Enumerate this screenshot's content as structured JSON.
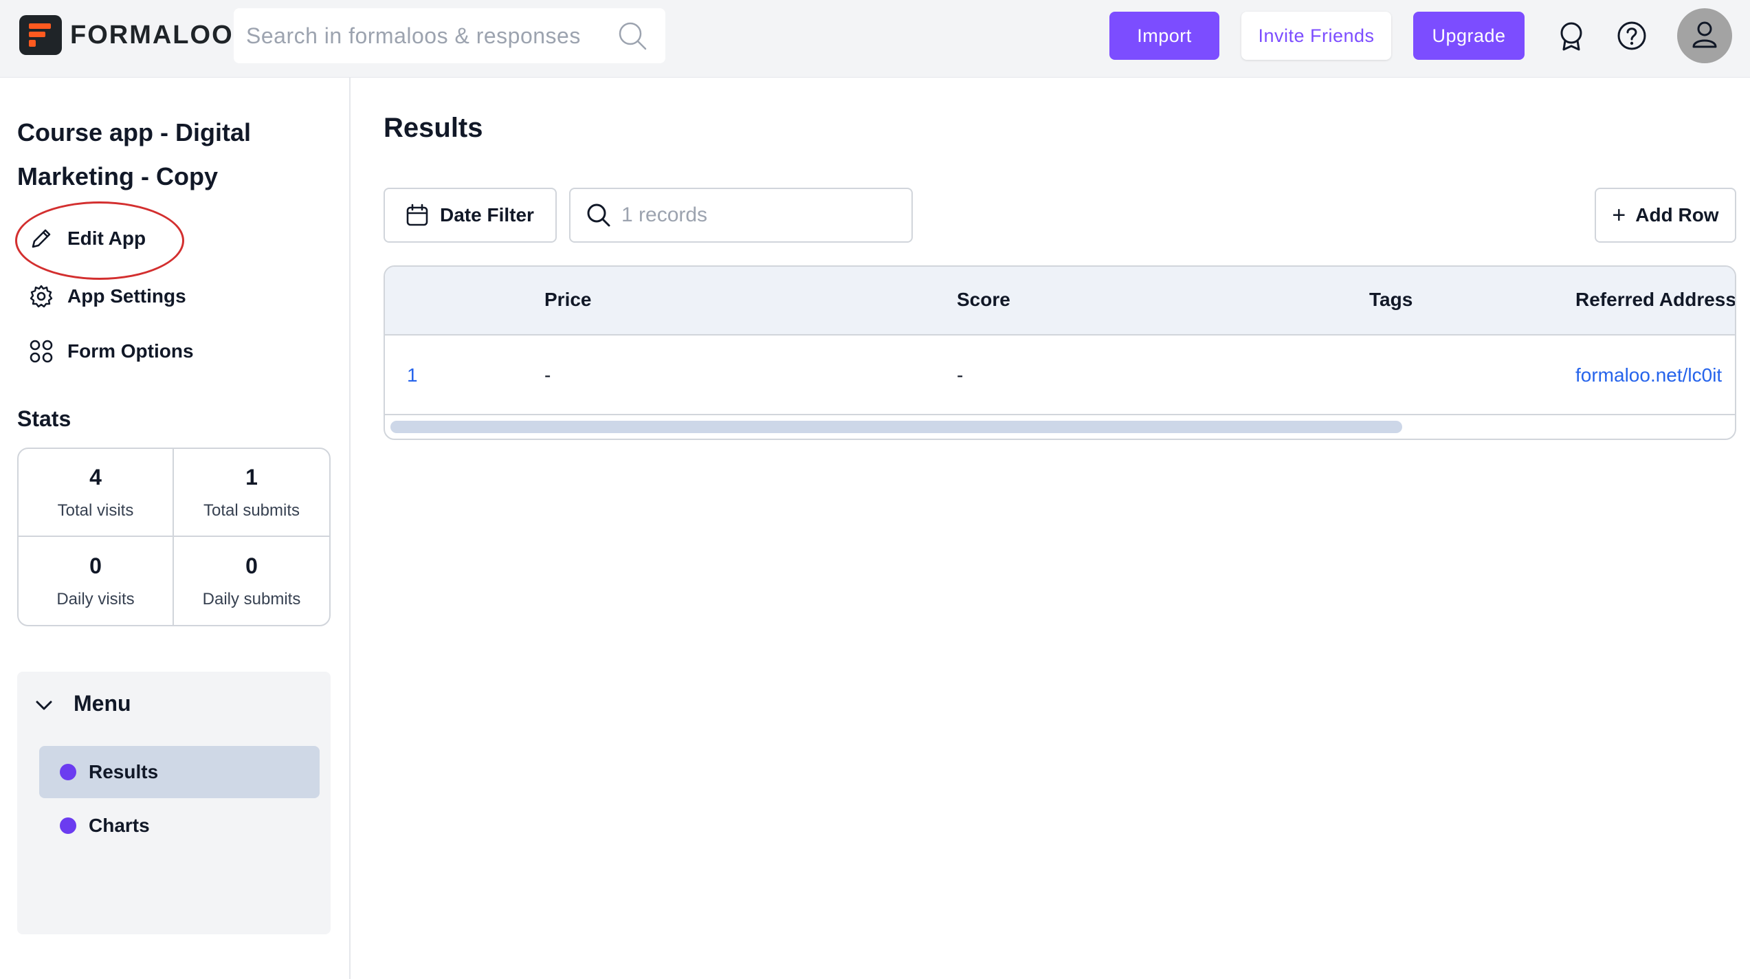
{
  "brand": {
    "name": "FORMALOO",
    "accent": "#7c4dff",
    "logo_orange": "#ff5a1f"
  },
  "search": {
    "placeholder": "Search in formaloos & responses"
  },
  "header": {
    "import_label": "Import",
    "invite_label": "Invite Friends",
    "upgrade_label": "Upgrade",
    "icons": [
      "badge-icon",
      "help-icon",
      "user-icon"
    ]
  },
  "sidebar": {
    "app_title": "Course app - Digital Marketing - Copy",
    "links": [
      {
        "label": "Edit App",
        "icon": "pencil-icon"
      },
      {
        "label": "App Settings",
        "icon": "gear-icon"
      },
      {
        "label": "Form Options",
        "icon": "grid-icon"
      }
    ],
    "stats_title": "Stats",
    "stats": [
      {
        "value": "4",
        "label": "Total visits"
      },
      {
        "value": "1",
        "label": "Total submits"
      },
      {
        "value": "0",
        "label": "Daily visits"
      },
      {
        "value": "0",
        "label": "Daily submits"
      }
    ],
    "menu": {
      "title": "Menu",
      "items": [
        {
          "label": "Results",
          "active": true
        },
        {
          "label": "Charts",
          "active": false
        }
      ]
    }
  },
  "main": {
    "title": "Results",
    "date_filter_label": "Date Filter",
    "records_placeholder": "1 records",
    "add_row_label": "Add Row",
    "table": {
      "columns": [
        "",
        "Price",
        "Score",
        "Tags",
        "Referred Address"
      ],
      "rows": [
        [
          "1",
          "-",
          "-",
          "",
          "formaloo.net/lc0it"
        ]
      ]
    }
  }
}
